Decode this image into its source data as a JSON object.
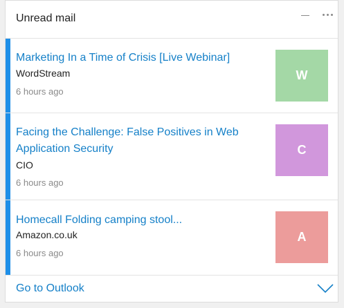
{
  "widget": {
    "title": "Unread mail",
    "minimize_icon": "minimize-icon",
    "more_icon": "more-options-icon"
  },
  "mails": [
    {
      "subject": "Marketing In a Time of Crisis [Live Webinar]",
      "sender": "WordStream",
      "time": "6 hours ago",
      "avatar_letter": "W",
      "avatar_color": "#a4d8a6"
    },
    {
      "subject": "Facing the Challenge: False Positives in Web Application Security",
      "sender": "CIO",
      "time": "6 hours ago",
      "avatar_letter": "C",
      "avatar_color": "#d197dc"
    },
    {
      "subject": "Homecall Folding camping stool...",
      "sender": "Amazon.co.uk",
      "time": "6 hours ago",
      "avatar_letter": "A",
      "avatar_color": "#ec9c9b"
    }
  ],
  "footer": {
    "label": "Go to Outlook",
    "chevron_icon": "chevron-down-icon"
  },
  "colors": {
    "accent": "#1e8fe8",
    "link": "#1580c8"
  }
}
